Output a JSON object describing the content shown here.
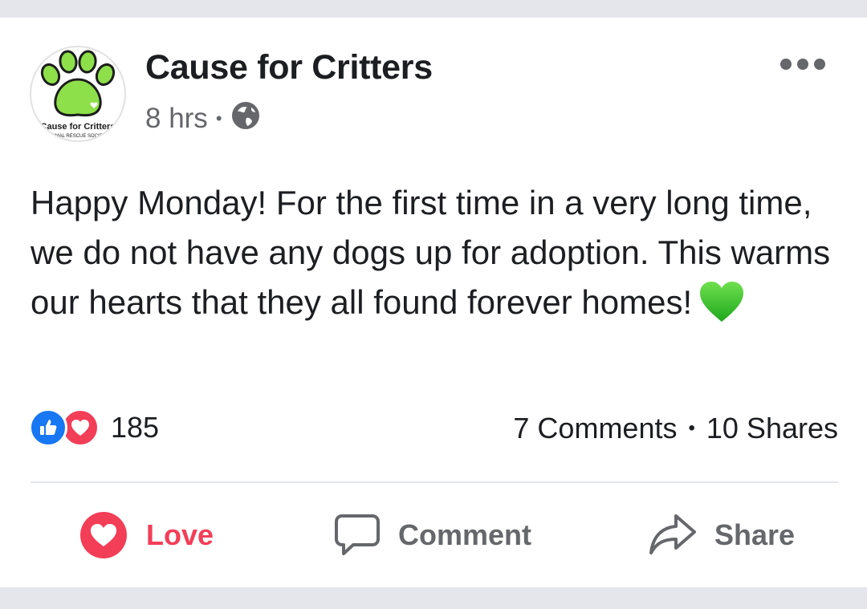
{
  "post": {
    "page_name": "Cause for Critters",
    "timestamp": "8 hrs",
    "separator": "•",
    "avatar_text_top": "Cause for Critters",
    "avatar_text_bottom": "ANIMAL RESCUE SOCIETY",
    "text": "Happy Monday! For the first time in a very long time, we do not have any dogs up for adoption. This warms our hearts that they all found forever homes!",
    "emoji": "green-heart"
  },
  "engagement": {
    "reaction_count": "185",
    "reaction_types": [
      "like",
      "love"
    ],
    "comments": "7 Comments",
    "shares": "10 Shares",
    "separator": "•"
  },
  "actions": {
    "love_label": "Love",
    "comment_label": "Comment",
    "share_label": "Share"
  },
  "colors": {
    "love_red": "#f33e58",
    "like_blue": "#1877f2",
    "paw_green": "#8ee04a",
    "heart_green": "#36c52a"
  }
}
